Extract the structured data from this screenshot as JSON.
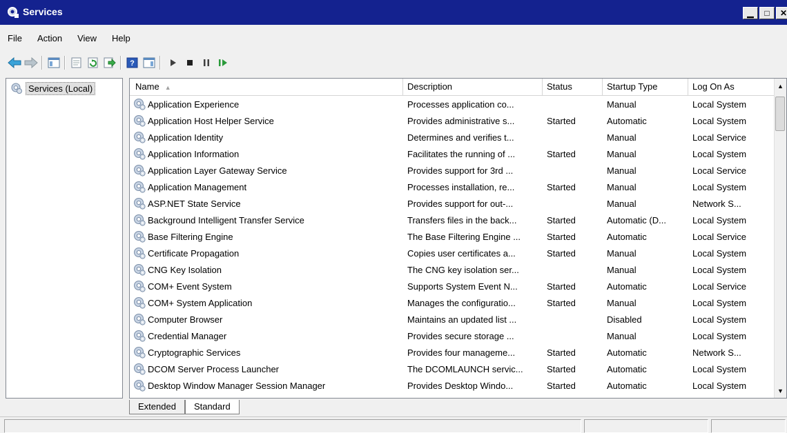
{
  "window": {
    "title": "Services"
  },
  "menu": [
    "File",
    "Action",
    "View",
    "Help"
  ],
  "toolbar": [
    "back-icon",
    "forward-icon",
    "show-hide-console-tree-icon",
    "properties-icon",
    "refresh-icon",
    "export-list-icon",
    "help-icon",
    "show-hide-action-pane-icon",
    "start-service-icon",
    "stop-service-icon",
    "pause-service-icon",
    "resume-service-icon"
  ],
  "tree": {
    "root": "Services (Local)"
  },
  "columns": {
    "name": "Name",
    "description": "Description",
    "status": "Status",
    "startup": "Startup Type",
    "logon": "Log On As"
  },
  "services": [
    {
      "name": "Application Experience",
      "description": "Processes application co...",
      "status": "",
      "startup": "Manual",
      "logon": "Local System"
    },
    {
      "name": "Application Host Helper Service",
      "description": "Provides administrative s...",
      "status": "Started",
      "startup": "Automatic",
      "logon": "Local System"
    },
    {
      "name": "Application Identity",
      "description": "Determines and verifies t...",
      "status": "",
      "startup": "Manual",
      "logon": "Local Service"
    },
    {
      "name": "Application Information",
      "description": "Facilitates the running of ...",
      "status": "Started",
      "startup": "Manual",
      "logon": "Local System"
    },
    {
      "name": "Application Layer Gateway Service",
      "description": "Provides support for 3rd ...",
      "status": "",
      "startup": "Manual",
      "logon": "Local Service"
    },
    {
      "name": "Application Management",
      "description": "Processes installation, re...",
      "status": "Started",
      "startup": "Manual",
      "logon": "Local System"
    },
    {
      "name": "ASP.NET State Service",
      "description": "Provides support for out-...",
      "status": "",
      "startup": "Manual",
      "logon": "Network S..."
    },
    {
      "name": "Background Intelligent Transfer Service",
      "description": "Transfers files in the back...",
      "status": "Started",
      "startup": "Automatic (D...",
      "logon": "Local System"
    },
    {
      "name": "Base Filtering Engine",
      "description": "The Base Filtering Engine ...",
      "status": "Started",
      "startup": "Automatic",
      "logon": "Local Service"
    },
    {
      "name": "Certificate Propagation",
      "description": "Copies user certificates a...",
      "status": "Started",
      "startup": "Manual",
      "logon": "Local System"
    },
    {
      "name": "CNG Key Isolation",
      "description": "The CNG key isolation ser...",
      "status": "",
      "startup": "Manual",
      "logon": "Local System"
    },
    {
      "name": "COM+ Event System",
      "description": "Supports System Event N...",
      "status": "Started",
      "startup": "Automatic",
      "logon": "Local Service"
    },
    {
      "name": "COM+ System Application",
      "description": "Manages the configuratio...",
      "status": "Started",
      "startup": "Manual",
      "logon": "Local System"
    },
    {
      "name": "Computer Browser",
      "description": "Maintains an updated list ...",
      "status": "",
      "startup": "Disabled",
      "logon": "Local System"
    },
    {
      "name": "Credential Manager",
      "description": "Provides secure storage ...",
      "status": "",
      "startup": "Manual",
      "logon": "Local System"
    },
    {
      "name": "Cryptographic Services",
      "description": "Provides four manageme...",
      "status": "Started",
      "startup": "Automatic",
      "logon": "Network S..."
    },
    {
      "name": "DCOM Server Process Launcher",
      "description": "The DCOMLAUNCH servic...",
      "status": "Started",
      "startup": "Automatic",
      "logon": "Local System"
    },
    {
      "name": "Desktop Window Manager Session Manager",
      "description": "Provides Desktop Windo...",
      "status": "Started",
      "startup": "Automatic",
      "logon": "Local System"
    }
  ],
  "tabs": [
    "Extended",
    "Standard"
  ],
  "active_tab": "Standard"
}
